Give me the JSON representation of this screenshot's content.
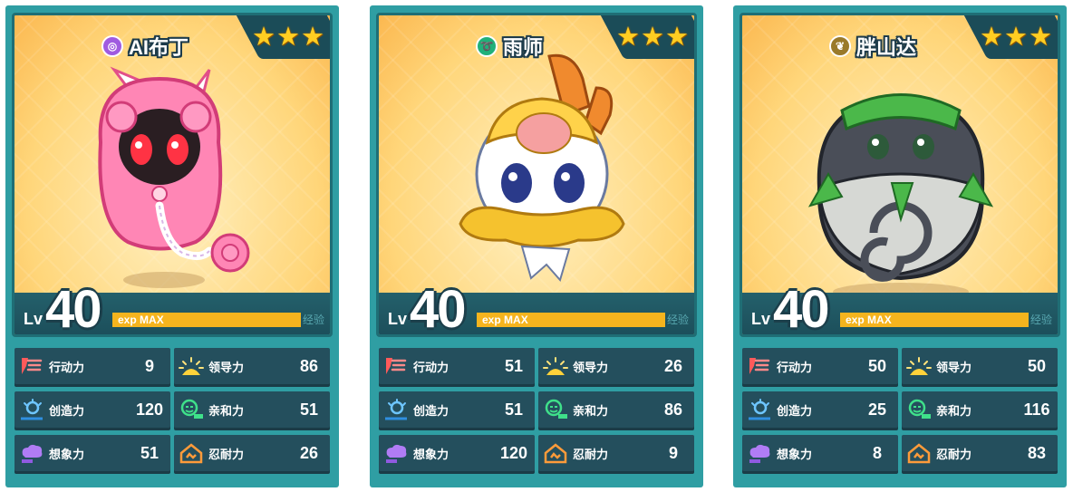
{
  "cards": [
    {
      "name": "AI布丁",
      "element_icon": "psychic-element-icon",
      "element_color": "#a05be0",
      "stars": 3,
      "level_label": "Lv",
      "level": "40",
      "exp_label": "exp",
      "exp_status": "MAX",
      "exp_button": "经验",
      "stats": [
        {
          "label": "行动力",
          "value": "9",
          "icon": "action-icon"
        },
        {
          "label": "领导力",
          "value": "86",
          "icon": "leadership-icon"
        },
        {
          "label": "创造力",
          "value": "120",
          "icon": "creativity-icon"
        },
        {
          "label": "亲和力",
          "value": "51",
          "icon": "affinity-icon"
        },
        {
          "label": "想象力",
          "value": "51",
          "icon": "imagination-icon"
        },
        {
          "label": "忍耐力",
          "value": "26",
          "icon": "endurance-icon"
        }
      ]
    },
    {
      "name": "雨师",
      "element_icon": "wind-element-icon",
      "element_color": "#20b07a",
      "stars": 3,
      "level_label": "Lv",
      "level": "40",
      "exp_label": "exp",
      "exp_status": "MAX",
      "exp_button": "经验",
      "stats": [
        {
          "label": "行动力",
          "value": "51",
          "icon": "action-icon"
        },
        {
          "label": "领导力",
          "value": "26",
          "icon": "leadership-icon"
        },
        {
          "label": "创造力",
          "value": "51",
          "icon": "creativity-icon"
        },
        {
          "label": "亲和力",
          "value": "86",
          "icon": "affinity-icon"
        },
        {
          "label": "想象力",
          "value": "120",
          "icon": "imagination-icon"
        },
        {
          "label": "忍耐力",
          "value": "9",
          "icon": "endurance-icon"
        }
      ]
    },
    {
      "name": "胖山达",
      "element_icon": "grass-element-icon",
      "element_color": "#9a7a2a",
      "stars": 3,
      "level_label": "Lv",
      "level": "40",
      "exp_label": "exp",
      "exp_status": "MAX",
      "exp_button": "经验",
      "stats": [
        {
          "label": "行动力",
          "value": "50",
          "icon": "action-icon"
        },
        {
          "label": "领导力",
          "value": "50",
          "icon": "leadership-icon"
        },
        {
          "label": "创造力",
          "value": "25",
          "icon": "creativity-icon"
        },
        {
          "label": "亲和力",
          "value": "116",
          "icon": "affinity-icon"
        },
        {
          "label": "想象力",
          "value": "8",
          "icon": "imagination-icon"
        },
        {
          "label": "忍耐力",
          "value": "83",
          "icon": "endurance-icon"
        }
      ]
    }
  ],
  "colors": {
    "card_border": "#2f9ea3",
    "stat_bg": "#244f5d",
    "exp_bar": "#f5b41e",
    "star": "#ffce22"
  }
}
